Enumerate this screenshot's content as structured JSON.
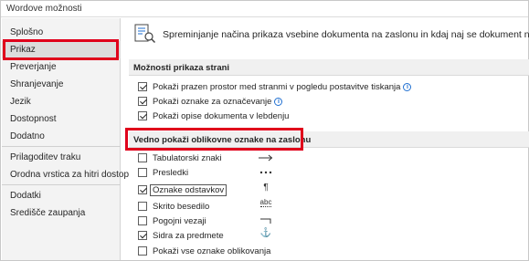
{
  "window": {
    "title": "Wordove možnosti"
  },
  "sidebar": {
    "items": [
      {
        "label": "Splošno"
      },
      {
        "label": "Prikaz"
      },
      {
        "label": "Preverjanje"
      },
      {
        "label": "Shranjevanje"
      },
      {
        "label": "Jezik"
      },
      {
        "label": "Dostopnost"
      },
      {
        "label": "Dodatno"
      },
      {
        "label": "Prilagoditev traku"
      },
      {
        "label": "Orodna vrstica za hitri dostop"
      },
      {
        "label": "Dodatki"
      },
      {
        "label": "Središče zaupanja"
      }
    ],
    "selected": "Prikaz"
  },
  "header": {
    "text": "Spreminjanje načina prikaza vsebine dokumenta na zaslonu in kdaj naj se dokument natisne",
    "icon": "document-display-icon"
  },
  "page_display": {
    "heading": "Možnosti prikaza strani",
    "options": [
      {
        "label": "Pokaži prazen prostor med stranmi v pogledu postavitve tiskanja",
        "checked": true,
        "info": true
      },
      {
        "label": "Pokaži oznake za označevanje",
        "checked": true,
        "info": true
      },
      {
        "label": "Pokaži opise dokumenta v lebdenju",
        "checked": true,
        "info": false
      }
    ]
  },
  "formatting_marks": {
    "heading": "Vedno pokaži oblikovne oznake na zaslonu",
    "options": [
      {
        "label": "Tabulatorski znaki",
        "checked": false,
        "mark": "tab-arrow-icon"
      },
      {
        "label": "Presledki",
        "checked": false,
        "mark": "space-dots-icon"
      },
      {
        "label": "Oznake odstavkov",
        "checked": true,
        "mark": "pilcrow-icon",
        "focused": true
      },
      {
        "label": "Skrito besedilo",
        "checked": false,
        "mark": "hidden-text-icon"
      },
      {
        "label": "Pogojni vezaji",
        "checked": false,
        "mark": "optional-hyphen-icon"
      },
      {
        "label": "Sidra za predmete",
        "checked": true,
        "mark": "anchor-icon"
      },
      {
        "label": "Pokaži vse oznake oblikovanja",
        "checked": false,
        "mark": ""
      }
    ],
    "glyphs": {
      "pilcrow": "¶",
      "hidden_text": "abc",
      "anchor": "⚓"
    }
  },
  "colors": {
    "highlight_frame": "#e0001b",
    "selected_bg": "#dcdcdc",
    "info_blue": "#1f6fd1"
  }
}
